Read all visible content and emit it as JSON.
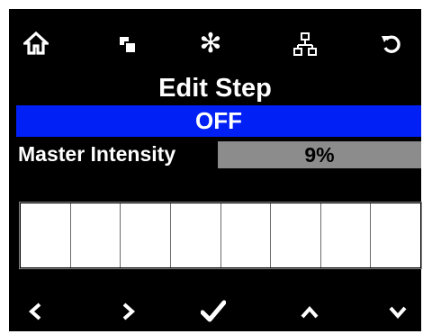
{
  "top_bar": {
    "icons": [
      "home-icon",
      "copy-icon",
      "asterisk-icon",
      "network-icon",
      "undo-icon"
    ],
    "asterisk_glyph": "✻"
  },
  "header": {
    "title": "Edit Step"
  },
  "status": {
    "text": "OFF",
    "color": "#0020f5"
  },
  "master_intensity": {
    "label": "Master Intensity",
    "value": "9%",
    "percent": 9
  },
  "step_grid": {
    "cells": 8
  },
  "bottom_bar": {
    "icons": [
      "chevron-left-icon",
      "chevron-right-icon",
      "checkmark-icon",
      "chevron-up-icon",
      "chevron-down-icon"
    ]
  }
}
